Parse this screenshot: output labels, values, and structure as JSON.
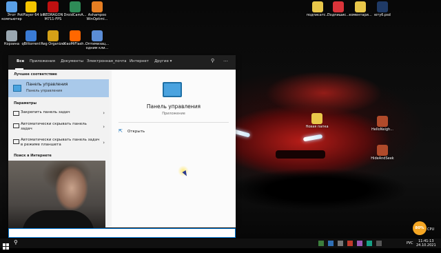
{
  "desktop_icons_left": [
    {
      "label": "Этот компьютер",
      "color": "#5aa0e6"
    },
    {
      "label": "PotPlayer 64 bit",
      "color": "#f5c400"
    },
    {
      "label": "REDRAGON M711-FPS",
      "color": "#c01010"
    },
    {
      "label": "DroidCamA...",
      "color": "#2e8b57"
    },
    {
      "label": "Ashampoo WinOptimi...",
      "color": "#e67e22"
    },
    {
      "label": "Корзина",
      "color": "#9aa7b0"
    },
    {
      "label": "qBittorrent",
      "color": "#3a7bd5"
    },
    {
      "label": "Reg Organizer",
      "color": "#d4a017"
    },
    {
      "label": "XiaoMiFlash...",
      "color": "#ff6700"
    },
    {
      "label": "Оптимизац... одним кли...",
      "color": "#5b8dd6"
    }
  ],
  "desktop_icons_right": [
    {
      "label": "подписатс...",
      "color": "#e8c74a"
    },
    {
      "label": "Подпишис...",
      "color": "#d9343a"
    },
    {
      "label": "коментари...",
      "color": "#e8c74a"
    },
    {
      "label": "ютуб.psd",
      "color": "#1f3a66"
    },
    {
      "label": "Новая папка",
      "color": "#e8c74a"
    },
    {
      "label": "HelloNeigh...",
      "color": "#b04a2a"
    },
    {
      "label": "HideAndSeek",
      "color": "#b04a2a"
    }
  ],
  "search_panel": {
    "tabs": [
      "Все",
      "Приложения",
      "Документы",
      "Электронная_почта",
      "Интернет",
      "Другие ▾"
    ],
    "best_match_title": "Лучшее соответствие",
    "best_match": {
      "title": "Панель управления",
      "subtitle": "Панель управления"
    },
    "settings_title": "Параметры",
    "settings": [
      "Закрепить панель задач",
      "Автоматически скрывать панель задач",
      "Автоматически скрывать панель задач в режиме планшета"
    ],
    "web_title": "Поиск в Интернете",
    "preview": {
      "title": "Панель управления",
      "subtitle": "Приложение",
      "action": "Открыть"
    },
    "more_icon": "…"
  },
  "taskbar": {
    "lang": "РУС",
    "time": "11:41:13",
    "date": "24.10.2021"
  },
  "badge": {
    "percent": "80%",
    "label": "CPU"
  }
}
